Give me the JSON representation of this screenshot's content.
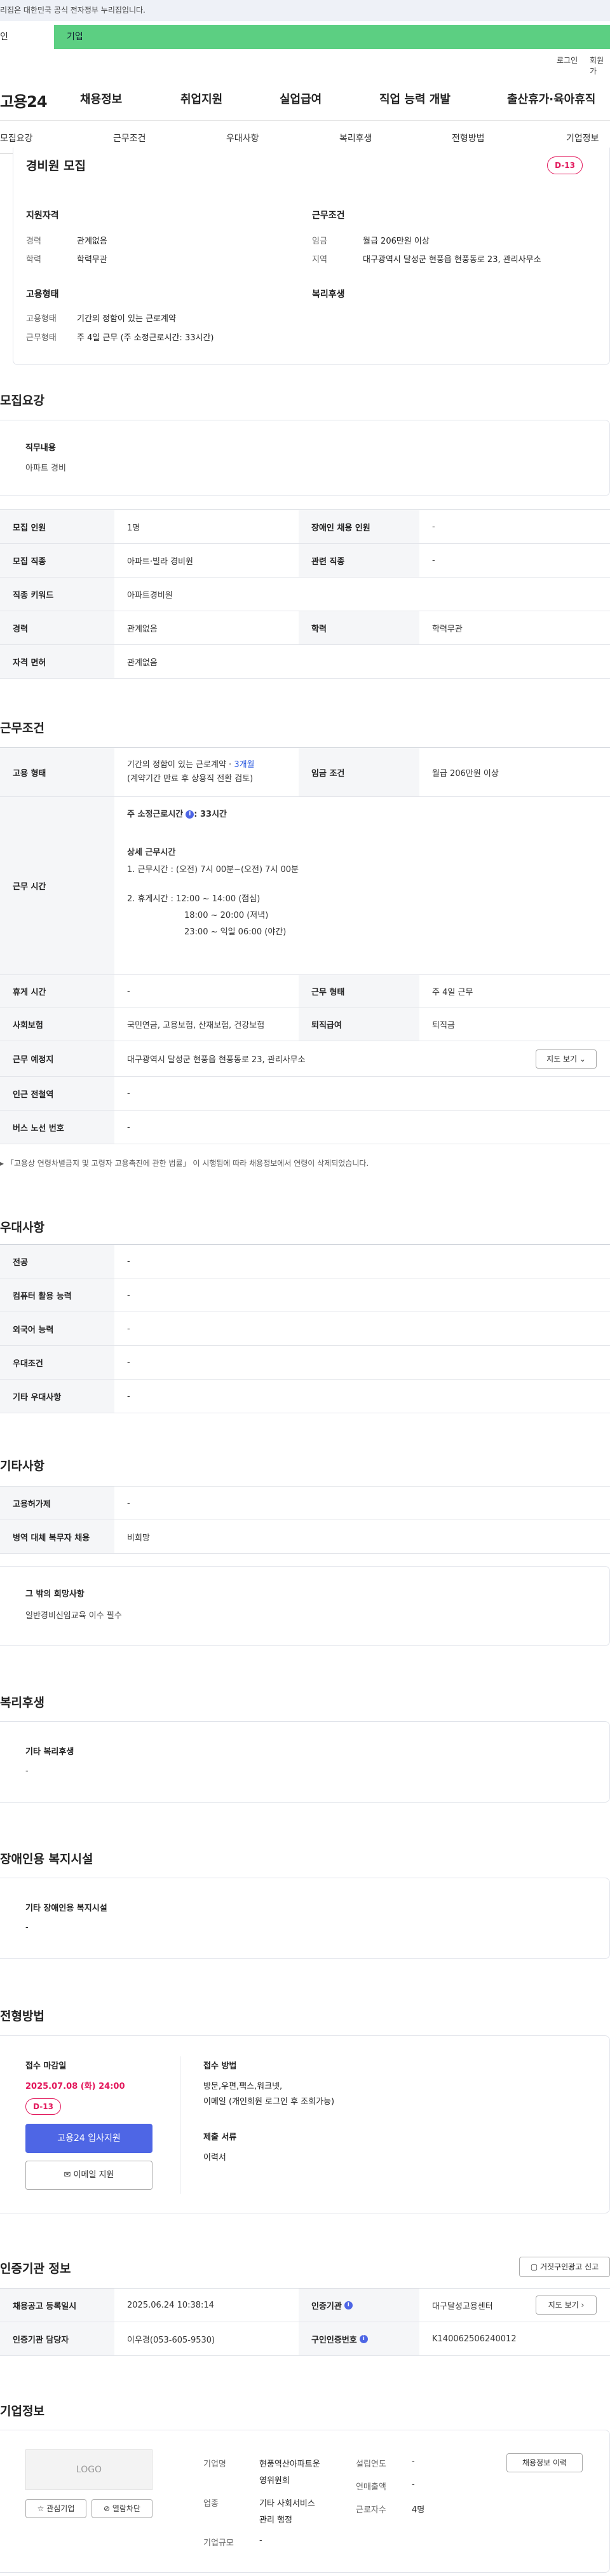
{
  "gov_notice": "리집은 대한민국 공식 전자정부 누리집입니다.",
  "tabs": {
    "left": "인",
    "right": "기업"
  },
  "util": {
    "login": "로그인",
    "join": "회원가"
  },
  "logo": "고용24",
  "gnb": [
    "채용정보",
    "취업지원",
    "실업급여",
    "직업 능력 개발",
    "출산휴가·육아휴직"
  ],
  "anchor": [
    "모집요강",
    "근무조건",
    "우대사항",
    "복리후생",
    "전형방법",
    "기업정보"
  ],
  "summary": {
    "title": "경비원 모집",
    "dday": "D-13",
    "qual_title": "지원자격",
    "career_l": "경력",
    "career_v": "관계없음",
    "edu_l": "학력",
    "edu_v": "학력무관",
    "cond_title": "근무조건",
    "wage_l": "임금",
    "wage_v": "월급 206만원 이상",
    "region_l": "지역",
    "region_v": "대구광역시 달성군 현풍읍 현풍동로 23, 관리사무소",
    "emp_title": "고용형태",
    "emptype_l": "고용형태",
    "emptype_v": "기간의 정함이 있는 근로계약",
    "workhours_l": "근무형태",
    "workhours_v": "주 4일 근무 (주 소정근로시간: 33시간)",
    "welfare_title": "복리후생"
  },
  "recruit": {
    "title": "모집요강",
    "duty_l": "직무내용",
    "duty_v": "아파트 경비",
    "rows": [
      [
        "모집 인원",
        "1명",
        "장애인 채용 인원",
        "-"
      ],
      [
        "모집 직종",
        "아파트·빌라 경비원",
        "관련 직종",
        "-"
      ],
      [
        "직종 키워드",
        "아파트경비원"
      ],
      [
        "경력",
        "관계없음",
        "학력",
        "학력무관"
      ],
      [
        "자격 면허",
        "관계없음"
      ]
    ]
  },
  "work": {
    "title": "근무조건",
    "emp_l": "고용 형태",
    "emp_v1": "기간의 정함이 있는 근로계약 · ",
    "emp_v1b": "3개월",
    "emp_v2": "(계약기간 만료 후 상용직 전환 검토)",
    "wage_l": "임금 조건",
    "wage_v": "월급 206만원 이상",
    "hours_l": "근무 시간",
    "hours_main": "주 소정근로시간",
    "hours_main_v": ": 33시간",
    "detail_title": "상세 근무시간",
    "detail_1": "1. 근무시간 : (오전) 7시 00분~(오전) 7시 00분",
    "detail_2": "2. 휴게시간 : 12:00 ~ 14:00 (점심)",
    "detail_3": "18:00 ~ 20:00 (저녁)",
    "detail_4": "23:00 ~ 익일 06:00 (야간)",
    "break_l": "휴게 시간",
    "break_v": "-",
    "shift_l": "근무 형태",
    "shift_v": "주 4일 근무",
    "ins_l": "사회보험",
    "ins_v": "국민연금, 고용보험, 산재보험, 건강보험",
    "sev_l": "퇴직급여",
    "sev_v": "퇴직금",
    "place_l": "근무 예정지",
    "place_v": "대구광역시 달성군 현풍읍 현풍동로 23, 관리사무소",
    "map_btn": "지도 보기",
    "sub_l": "인근 전철역",
    "sub_v": "-",
    "bus_l": "버스 노선 번호",
    "bus_v": "-",
    "note": "▸ 「고용상 연령차별금지 및 고령자 고용촉진에 관한 법률」 이 시행됨에 따라 채용정보에서 연령이 삭제되었습니다."
  },
  "pref": {
    "title": "우대사항",
    "rows": [
      [
        "전공",
        "-"
      ],
      [
        "컴퓨터 활용 능력",
        "-"
      ],
      [
        "외국어 능력",
        "-"
      ],
      [
        "우대조건",
        "-"
      ],
      [
        "기타 우대사항",
        "-"
      ]
    ]
  },
  "etc": {
    "title": "기타사항",
    "rows": [
      [
        "고용허가제",
        "-"
      ],
      [
        "병역 대체 복무자 채용",
        "비희망"
      ]
    ],
    "card_title": "그 밖의 희망사항",
    "card_v": "일반경비신임교육 이수 필수"
  },
  "welfare": {
    "title": "복리후생",
    "card_title": "기타 복리후생",
    "card_v": "-"
  },
  "disabled": {
    "title": "장애인용 복지시설",
    "card_title": "기타 장애인용 복지시설",
    "card_v": "-"
  },
  "selection": {
    "title": "전형방법",
    "deadline_l": "접수 마감일",
    "deadline_v": "2025.07.08 (화) 24:00",
    "dday": "D-13",
    "apply_btn": "고용24 입사지원",
    "email_btn": "이메일 지원",
    "method_l": "접수 방법",
    "method_v1": "방문,우편,팩스,워크넷,",
    "method_v2": "이메일 (개인회원 로그인 후 조회가능)",
    "docs_l": "제출 서류",
    "docs_v": "이력서"
  },
  "cert": {
    "title": "인증기관 정보",
    "report_btn": "거짓구인광고 신고",
    "rows": [
      [
        "채용공고 등록일시",
        "2025.06.24 10:38:14",
        "인증기관",
        "대구달성고용센터"
      ],
      [
        "인증기관 담당자",
        "이우경(053-605-9530)",
        "구인인증번호",
        "K140062506240012"
      ]
    ],
    "map_btn": "지도 보기"
  },
  "company": {
    "title": "기업정보",
    "logo": "LOGO",
    "fav_btn": "관심기업",
    "block_btn": "열람차단",
    "name_l": "기업명",
    "name_v1": "현풍역산아파트운",
    "name_v2": "영위원회",
    "found_l": "설립연도",
    "found_v": "-",
    "sales_l": "연매출액",
    "sales_v": "-",
    "ind_l": "업종",
    "ind_v1": "기타 사회서비스",
    "ind_v2": "관리 행정",
    "emp_l": "근로자수",
    "emp_v": "4명",
    "size_l": "기업규모",
    "size_v": "-",
    "hist_btn": "채용정보 이력"
  }
}
